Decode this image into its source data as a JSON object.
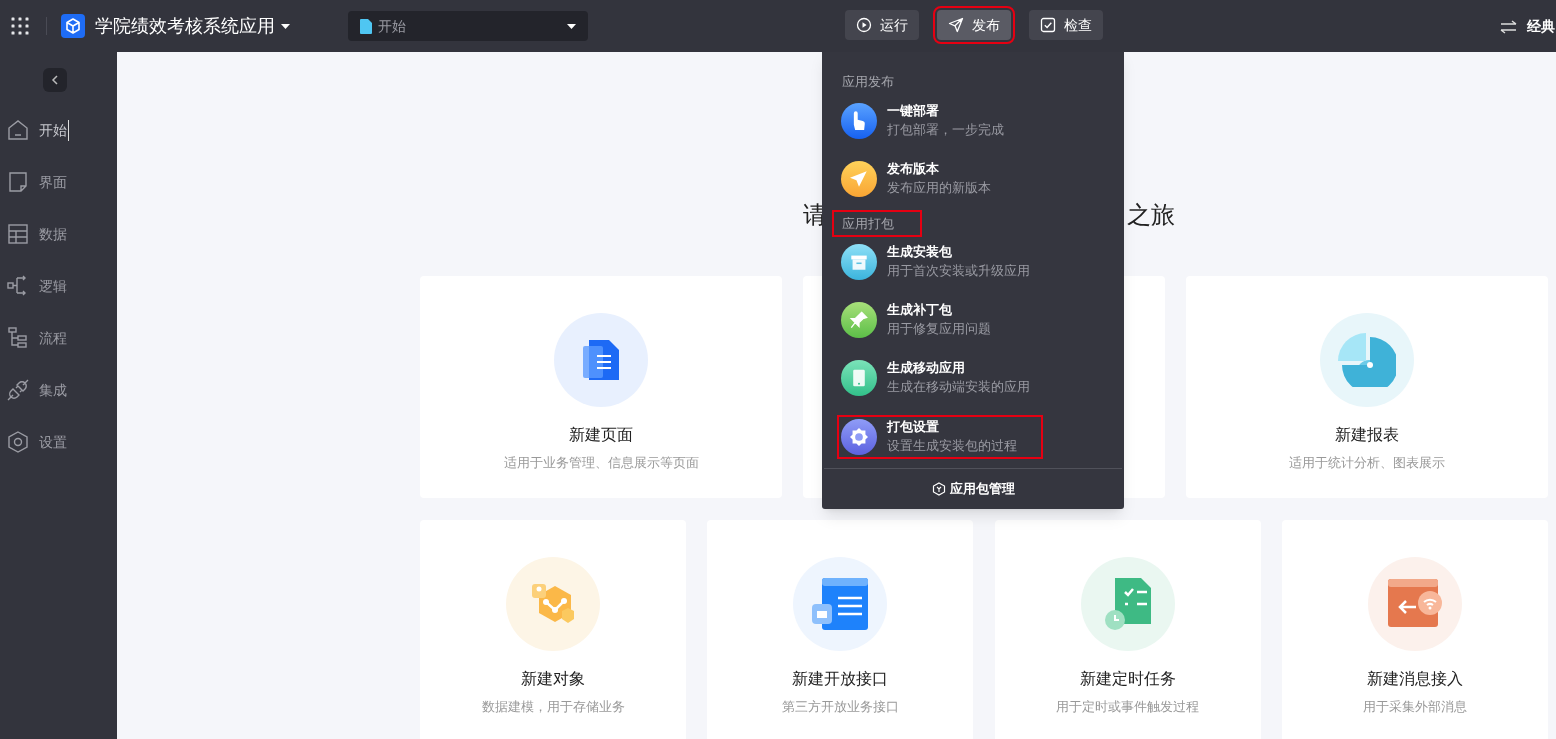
{
  "topbar": {
    "app_title": "学院绩效考核系统应用",
    "page_select": {
      "value": "开始"
    },
    "actions": [
      {
        "label": "运行",
        "selected": false,
        "highlighted": false
      },
      {
        "label": "发布",
        "selected": true,
        "highlighted": true
      },
      {
        "label": "检查",
        "selected": false,
        "highlighted": false
      }
    ],
    "mode_label": "经典"
  },
  "sidebar": {
    "items": [
      {
        "label": "开始",
        "selected": true
      },
      {
        "label": "界面",
        "selected": false
      },
      {
        "label": "数据",
        "selected": false
      },
      {
        "label": "逻辑",
        "selected": false
      },
      {
        "label": "流程",
        "selected": false
      },
      {
        "label": "集成",
        "selected": false
      },
      {
        "label": "设置",
        "selected": false
      }
    ]
  },
  "heading": {
    "part_1": "请",
    "part_2": "之旅"
  },
  "cards_row_1": [
    {
      "title": "新建页面",
      "description": "适用于业务管理、信息展示等页面"
    },
    {
      "title": "新建报表",
      "description": "适用于统计分析、图表展示"
    }
  ],
  "cards_row_2": [
    {
      "title": "新建对象",
      "description": "数据建模，用于存储业务"
    },
    {
      "title": "新建开放接口",
      "description": "第三方开放业务接口"
    },
    {
      "title": "新建定时任务",
      "description": "用于定时或事件触发过程"
    },
    {
      "title": "新建消息接入",
      "description": "用于采集外部消息"
    }
  ],
  "publish_menu": {
    "sections": [
      {
        "title": "应用发布",
        "highlighted": false,
        "items": [
          {
            "title": "一键部署",
            "description": "打包部署，一步完成",
            "highlighted": false
          },
          {
            "title": "发布版本",
            "description": "发布应用的新版本",
            "highlighted": false
          }
        ]
      },
      {
        "title": "应用打包",
        "highlighted": true,
        "items": [
          {
            "title": "生成安装包",
            "description": "用于首次安装或升级应用",
            "highlighted": false
          },
          {
            "title": "生成补丁包",
            "description": "用于修复应用问题",
            "highlighted": false
          },
          {
            "title": "生成移动应用",
            "description": "生成在移动端安装的应用",
            "highlighted": false
          },
          {
            "title": "打包设置",
            "description": "设置生成安装包的过程",
            "highlighted": true
          }
        ]
      }
    ],
    "footer_link": "应用包管理"
  }
}
